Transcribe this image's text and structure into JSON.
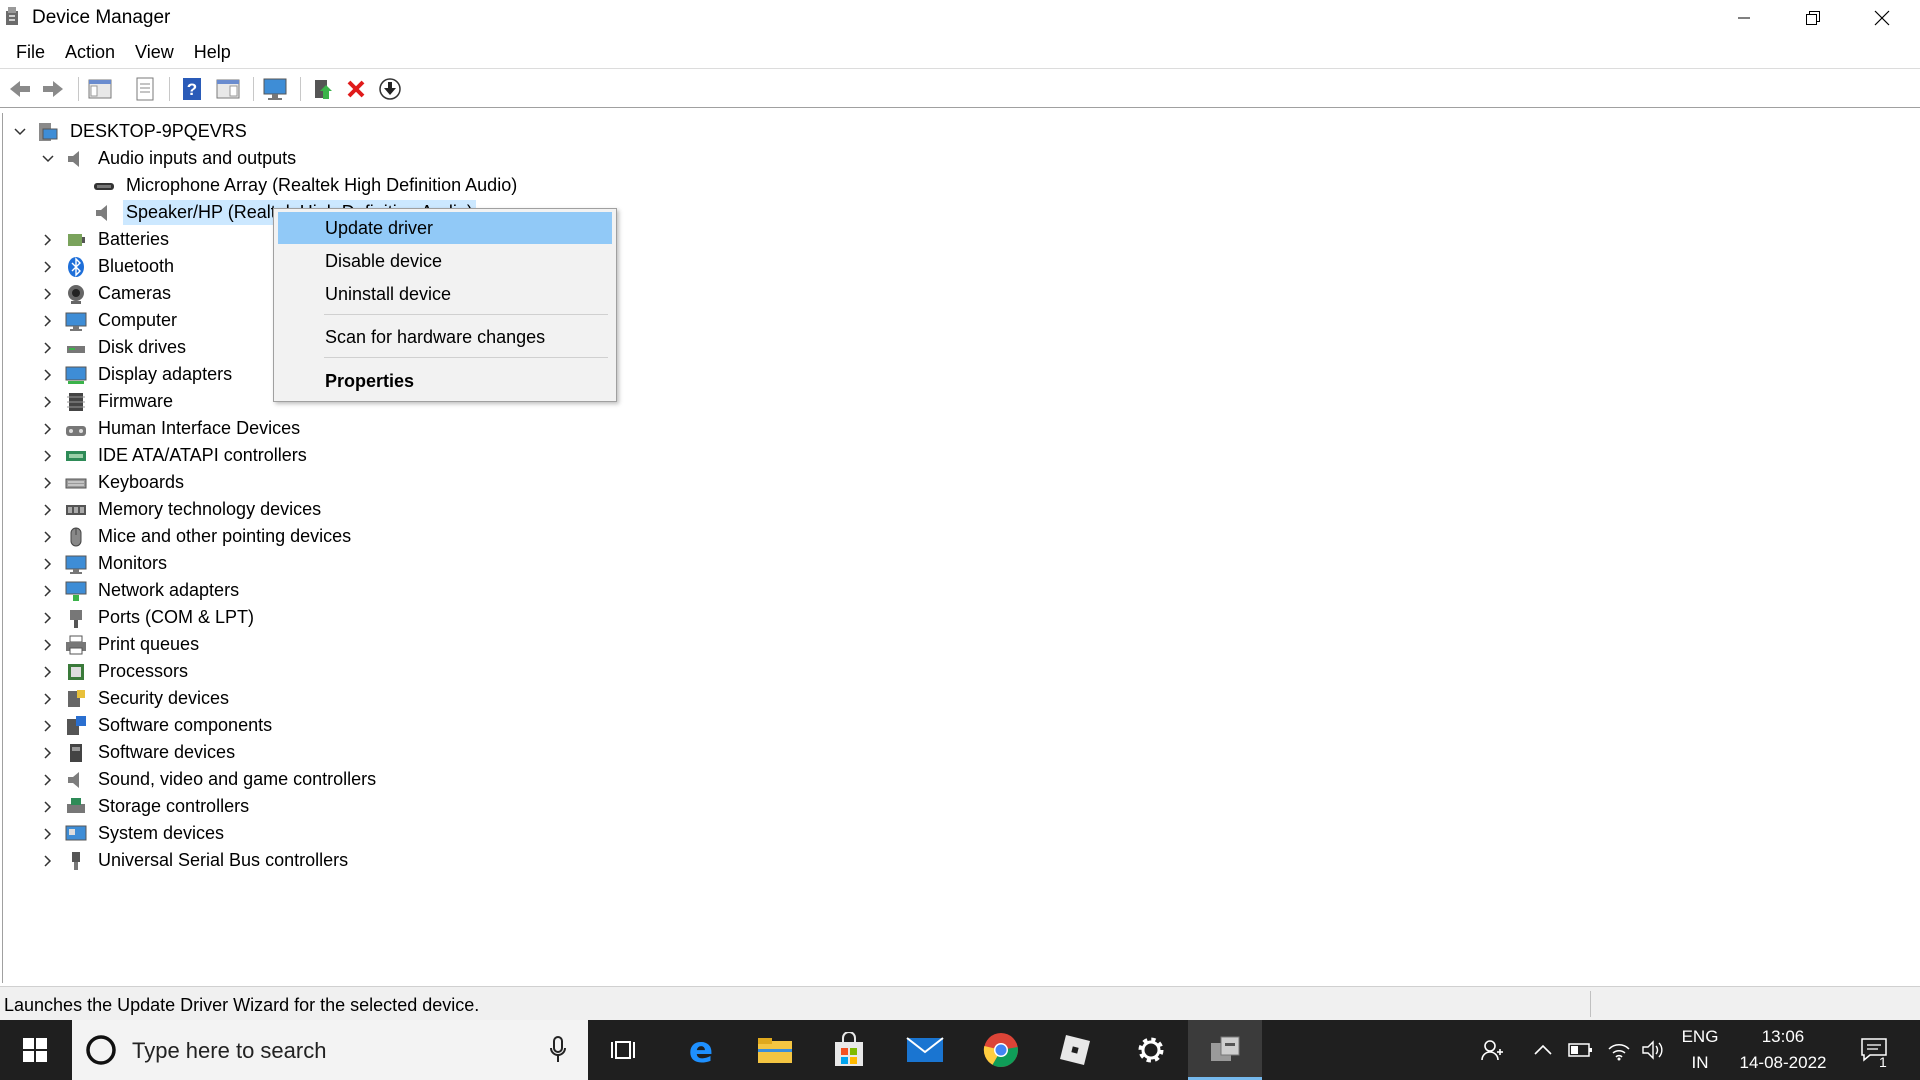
{
  "window": {
    "title": "Device Manager",
    "buttons": {
      "minimize": "minimize",
      "restore": "restore",
      "close": "close"
    }
  },
  "menu": [
    "File",
    "Action",
    "View",
    "Help"
  ],
  "tree": {
    "root": "DESKTOP-9PQEVRS",
    "audio_group": "Audio inputs and outputs",
    "audio_children": [
      "Microphone Array (Realtek High Definition Audio)",
      "Speaker/HP (Realtek High Definition Audio)"
    ],
    "categories": [
      {
        "label": "Batteries",
        "icon": "battery-icon"
      },
      {
        "label": "Bluetooth",
        "icon": "bluetooth-icon"
      },
      {
        "label": "Cameras",
        "icon": "camera-icon"
      },
      {
        "label": "Computer",
        "icon": "computer-icon"
      },
      {
        "label": "Disk drives",
        "icon": "disk-drive-icon"
      },
      {
        "label": "Display adapters",
        "icon": "display-adapter-icon"
      },
      {
        "label": "Firmware",
        "icon": "firmware-icon"
      },
      {
        "label": "Human Interface Devices",
        "icon": "hid-icon"
      },
      {
        "label": "IDE ATA/ATAPI controllers",
        "icon": "ide-controller-icon"
      },
      {
        "label": "Keyboards",
        "icon": "keyboard-icon"
      },
      {
        "label": "Memory technology devices",
        "icon": "memory-icon"
      },
      {
        "label": "Mice and other pointing devices",
        "icon": "mouse-icon"
      },
      {
        "label": "Monitors",
        "icon": "monitor-icon"
      },
      {
        "label": "Network adapters",
        "icon": "network-adapter-icon"
      },
      {
        "label": "Ports (COM & LPT)",
        "icon": "port-icon"
      },
      {
        "label": "Print queues",
        "icon": "printer-icon"
      },
      {
        "label": "Processors",
        "icon": "processor-icon"
      },
      {
        "label": "Security devices",
        "icon": "security-device-icon"
      },
      {
        "label": "Software components",
        "icon": "software-component-icon"
      },
      {
        "label": "Software devices",
        "icon": "software-device-icon"
      },
      {
        "label": "Sound, video and game controllers",
        "icon": "sound-controller-icon"
      },
      {
        "label": "Storage controllers",
        "icon": "storage-controller-icon"
      },
      {
        "label": "System devices",
        "icon": "system-device-icon"
      },
      {
        "label": "Universal Serial Bus controllers",
        "icon": "usb-icon"
      }
    ]
  },
  "context_menu": {
    "update": "Update driver",
    "disable": "Disable device",
    "uninstall": "Uninstall device",
    "scan": "Scan for hardware changes",
    "properties": "Properties"
  },
  "status": "Launches the Update Driver Wizard for the selected device.",
  "taskbar": {
    "search_placeholder": "Type here to search",
    "lang_top": "ENG",
    "lang_bottom": "IN",
    "time": "13:06",
    "date": "14-08-2022",
    "notification_count": "1"
  },
  "colors": {
    "selection": "#cce8ff",
    "menu_highlight": "#91c9f7",
    "taskbar_bg": "#1f1f1f",
    "accent": "#0078d7"
  }
}
